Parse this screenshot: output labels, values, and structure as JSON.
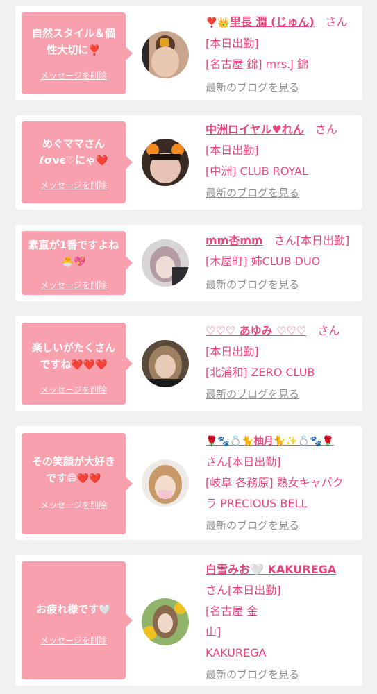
{
  "delete_label": "メッセージを削除",
  "blog_label": "最新のブログを見る",
  "san_label": "さん",
  "cards": [
    {
      "message": "自然スタイル＆個性大切に",
      "message_emoji": "❣️",
      "name": "里長 潤 (じゅん)",
      "name_prefix": "❣️👑",
      "status": "[本日出勤]",
      "shop": "[名古屋 錦] mrs.J 錦"
    },
    {
      "message": "めぐママさん ℓσνє♡にゃ",
      "message_emoji": "❤️",
      "name": "中洲ロイヤル♥れん",
      "name_prefix": "",
      "status": "[本日出勤]",
      "shop": "[中洲] CLUB ROYAL"
    },
    {
      "message": "素直が1番ですよね",
      "message_emoji": "🐣💖",
      "name": "₥₥杏₥₥",
      "name_prefix": "",
      "status": "[本日出勤]",
      "shop": "[木屋町] 姉CLUB DUO"
    },
    {
      "message": "楽しいがたくさんですね",
      "message_emoji": "❤️❤️❤️",
      "name": "♡♡♡ あゆみ ♡♡♡",
      "name_prefix": "",
      "status": "[本日出勤]",
      "shop": "[北浦和] ZERO CLUB"
    },
    {
      "message": "その笑顔が大好きです",
      "message_emoji": "😁❤️❤️",
      "name": "🌹🐾💍🐈柚月🐈✨💍🐾🌹",
      "name_prefix": "",
      "status": "[本日出勤]",
      "shop": "[岐阜 各務原] 熟女キャバクラ PRECIOUS BELL"
    },
    {
      "message": "お疲れ様です",
      "message_emoji": "🤍",
      "name": "白雪みお🤍 KAKUREGA",
      "name_prefix": "",
      "status": "[本日出勤]",
      "shop": "[名古屋 金山] KAKUREGA"
    }
  ],
  "colors": {
    "bubble": "#f8a0ae",
    "accent": "#e8457d",
    "link_gray": "#8d8d8d",
    "background": "#f1f1f1"
  }
}
